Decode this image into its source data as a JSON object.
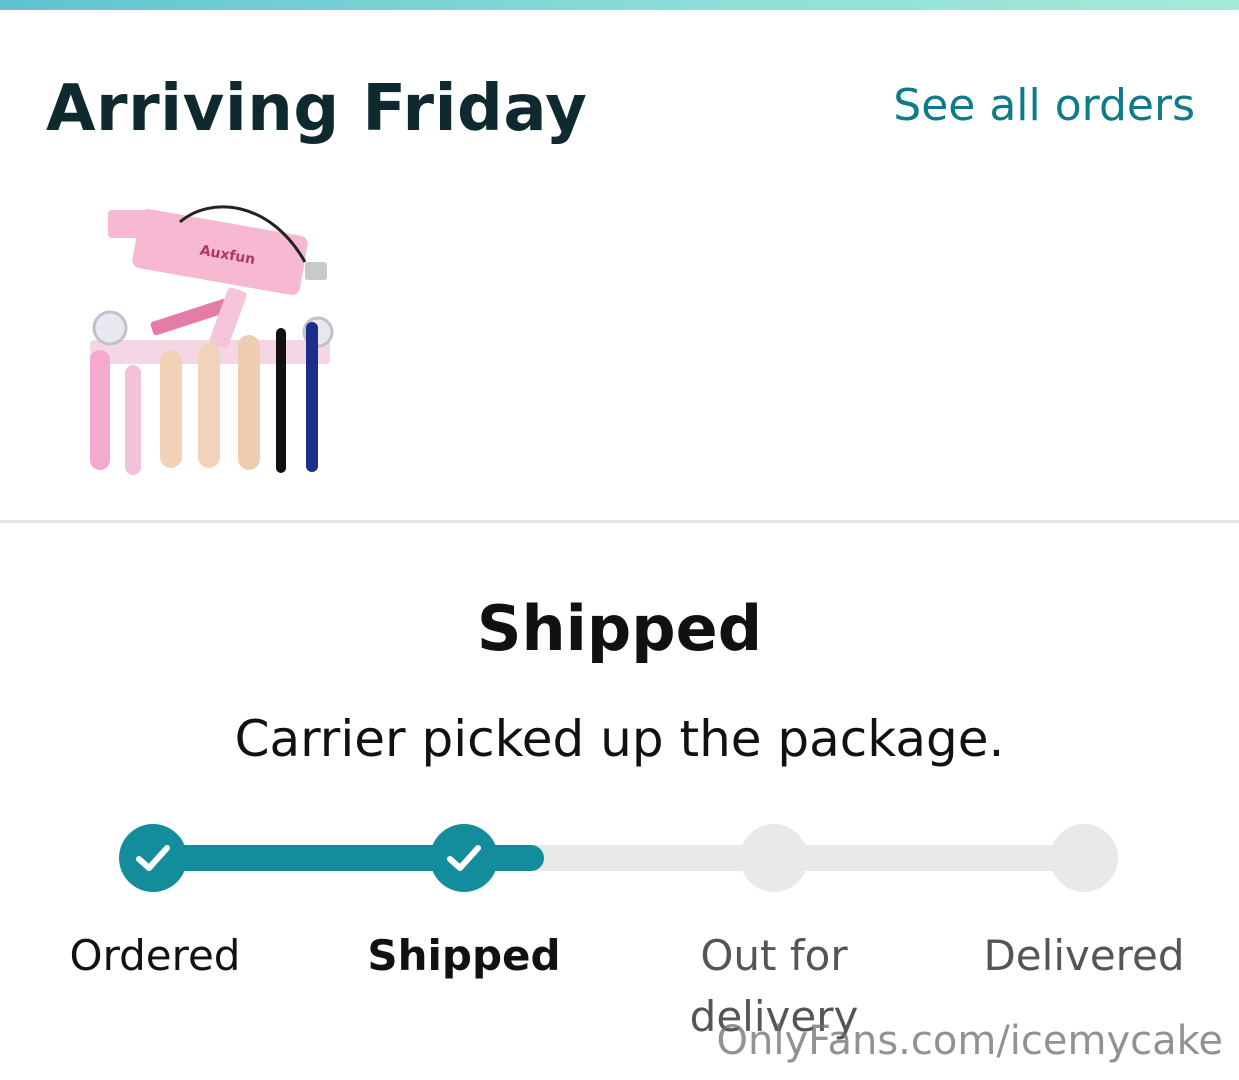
{
  "header": {
    "title": "Arriving Friday",
    "see_all_link": "See all orders"
  },
  "product": {
    "image_icon": "product-image",
    "brand_mark": "Auxfun"
  },
  "status": {
    "title": "Shipped",
    "detail": "Carrier picked up the package."
  },
  "tracker": {
    "progress": 0.42,
    "steps": [
      {
        "label": "Ordered",
        "state": "done"
      },
      {
        "label": "Shipped",
        "state": "done"
      },
      {
        "label": "Out for delivery",
        "state": "pending"
      },
      {
        "label": "Delivered",
        "state": "pending"
      }
    ],
    "accent_color": "#138c9b",
    "inactive_color": "#e9e9e9"
  },
  "watermark": "OnlyFans.com/icemycake"
}
